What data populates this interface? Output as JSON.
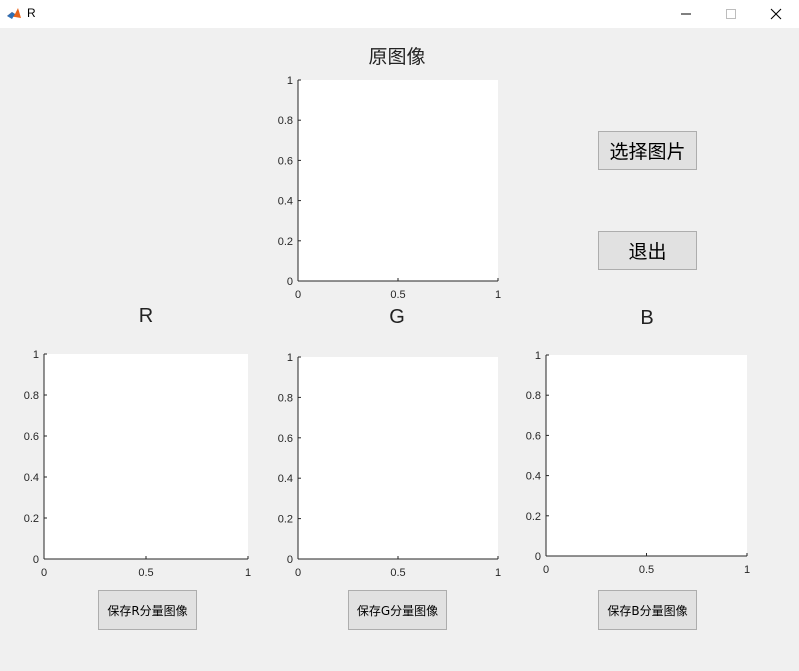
{
  "window": {
    "title": "R",
    "controls": {
      "minimize": "minimize-icon",
      "maximize": "maximize-icon",
      "close": "close-icon"
    }
  },
  "original_axes": {
    "title": "原图像"
  },
  "r_axes": {
    "title": "R"
  },
  "g_axes": {
    "title": "G"
  },
  "b_axes": {
    "title": "B"
  },
  "axis_ticks": {
    "x": [
      "0",
      "0.5",
      "1"
    ],
    "y": [
      "0",
      "0.2",
      "0.4",
      "0.6",
      "0.8",
      "1"
    ]
  },
  "buttons": {
    "select_image": "选择图片",
    "exit": "退出",
    "save_r": "保存R分量图像",
    "save_g": "保存G分量图像",
    "save_b": "保存B分量图像"
  },
  "colors": {
    "figure_bg": "#f0f0f0",
    "axes_bg": "#ffffff",
    "button_bg": "#e1e1e1",
    "axis_line": "#262626"
  }
}
